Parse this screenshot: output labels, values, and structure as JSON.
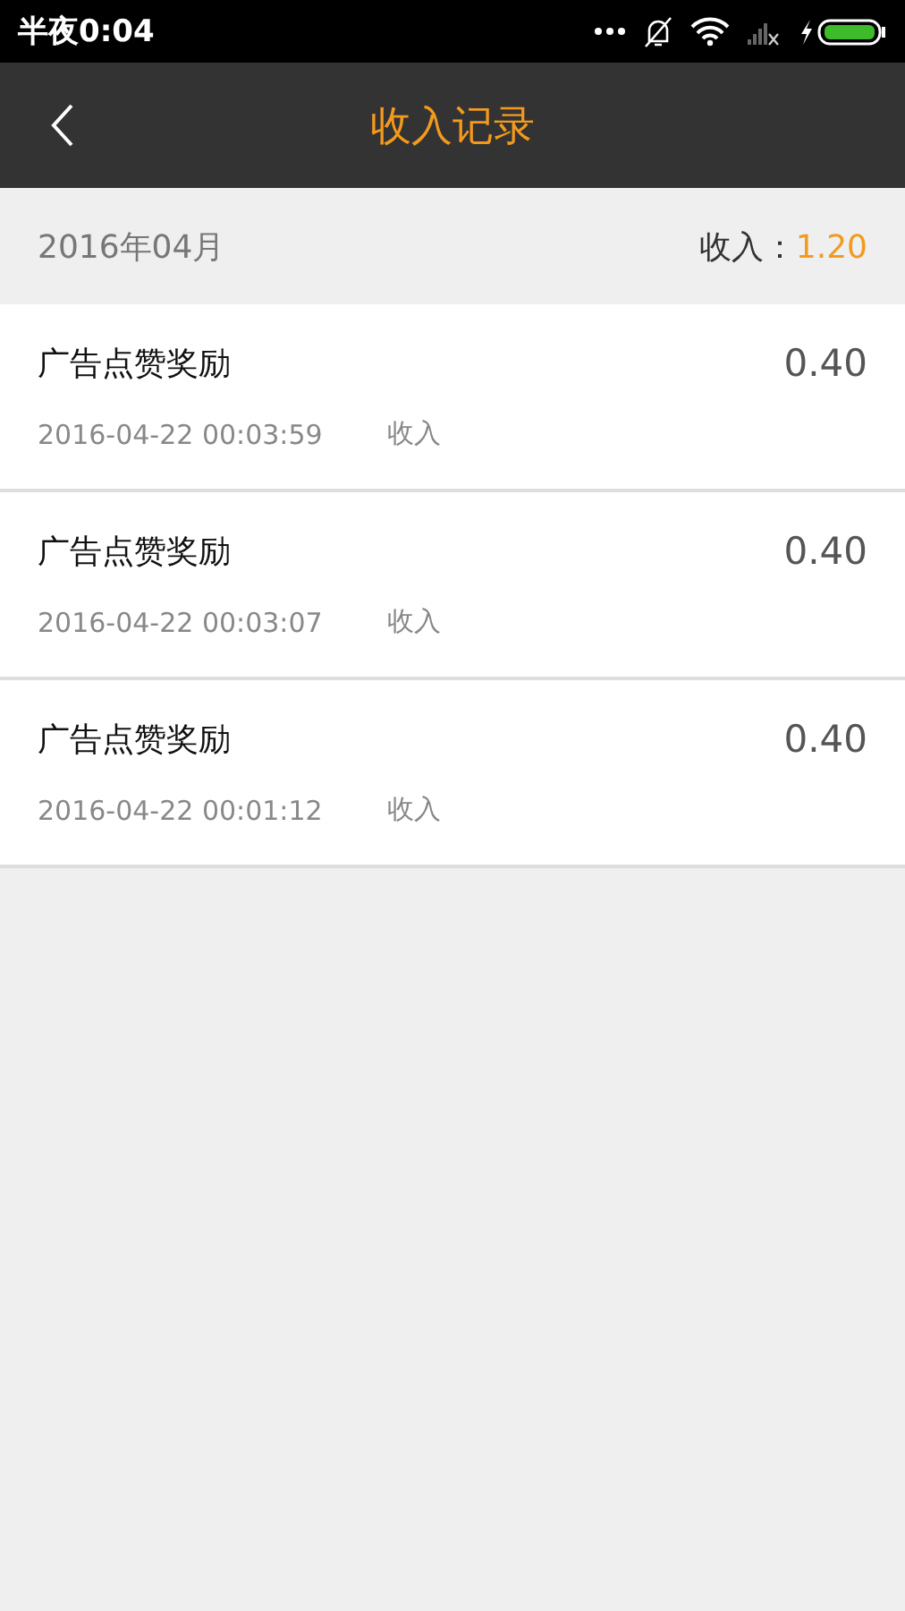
{
  "status_bar": {
    "time": "半夜0:04"
  },
  "header": {
    "title": "收入记录"
  },
  "month": {
    "label": "2016年04月",
    "total_label": "收入：",
    "total_value": "1.20"
  },
  "records": [
    {
      "title": "广告点赞奖励",
      "amount": "0.40",
      "time": "2016-04-22 00:03:59",
      "type": "收入"
    },
    {
      "title": "广告点赞奖励",
      "amount": "0.40",
      "time": "2016-04-22 00:03:07",
      "type": "收入"
    },
    {
      "title": "广告点赞奖励",
      "amount": "0.40",
      "time": "2016-04-22 00:01:12",
      "type": "收入"
    }
  ]
}
